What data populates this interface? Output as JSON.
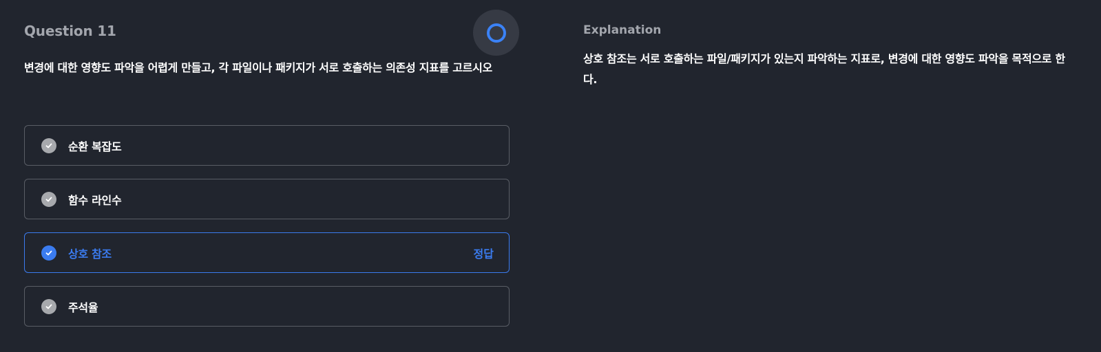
{
  "question": {
    "title": "Question 11",
    "text": "변경에 대한 영향도 파악을 어렵게 만들고, 각 파일이나 패키지가 서로 호출하는 의존성 지표를 고르시오"
  },
  "options": [
    {
      "label": "순환 복잡도",
      "correct": false
    },
    {
      "label": "함수 라인수",
      "correct": false
    },
    {
      "label": "상호 참조",
      "correct": true,
      "tag": "정답"
    },
    {
      "label": "주석율",
      "correct": false
    }
  ],
  "explanation": {
    "title": "Explanation",
    "text": "상호 참조는 서로 호출하는 파일/패키지가 있는지 파악하는 지표로, 변경에 대한 영향도 파악을 목적으로 한다."
  },
  "colors": {
    "background": "#21252e",
    "accent": "#3b7cf0",
    "muted": "#a3a6ad",
    "border": "#5a5e66"
  },
  "icons": {
    "status": "ring-icon",
    "option_check": "check-circle-icon"
  }
}
